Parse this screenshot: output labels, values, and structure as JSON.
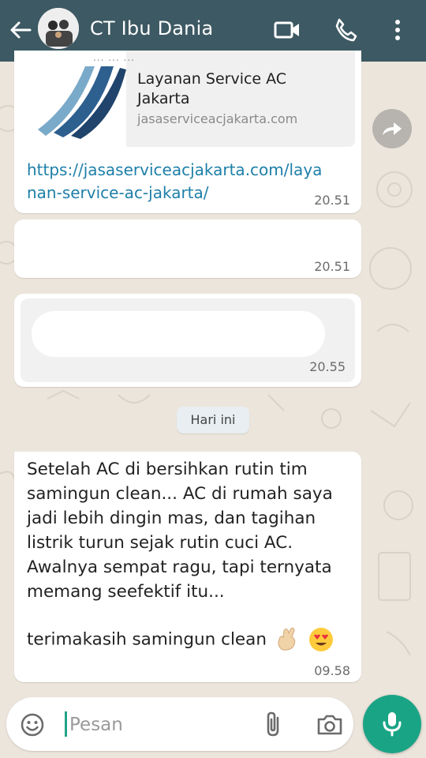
{
  "header": {
    "contact_name": "CT Ibu Dania",
    "icons": [
      "back-arrow-icon",
      "video-call-icon",
      "phone-call-icon",
      "more-vertical-icon"
    ],
    "background_color": "#3d5963"
  },
  "messages": [
    {
      "kind": "link-preview",
      "preview_header_fragment": "... ... ...",
      "preview_title": "Layanan Service AC Jakarta",
      "preview_domain": "jasaserviceacjakarta.com",
      "link": "https://jasaserviceacjakarta.com/layanan-service-ac-jakarta/",
      "time": "20.51"
    },
    {
      "kind": "redacted",
      "time": "20.51"
    },
    {
      "kind": "redacted-image",
      "time": "20.55"
    },
    {
      "kind": "text",
      "lines": [
        "Setelah AC di bersihkan rutin tim",
        "samingun clean... AC di rumah saya",
        "jadi lebih dingin mas, dan tagihan",
        "listrik turun sejak rutin cuci AC.",
        "Awalnya sempat ragu, tapi ternyata",
        "memang seefektif itu..."
      ],
      "thanks": "terimakasih samingun clean",
      "emojis": [
        "crossed-fingers-emoji",
        "heart-eyes-emoji"
      ],
      "time": "09.58"
    }
  ],
  "day_divider": "Hari ini",
  "composer": {
    "placeholder": "Pesan",
    "value": "",
    "accent_color": "#1aa486"
  }
}
